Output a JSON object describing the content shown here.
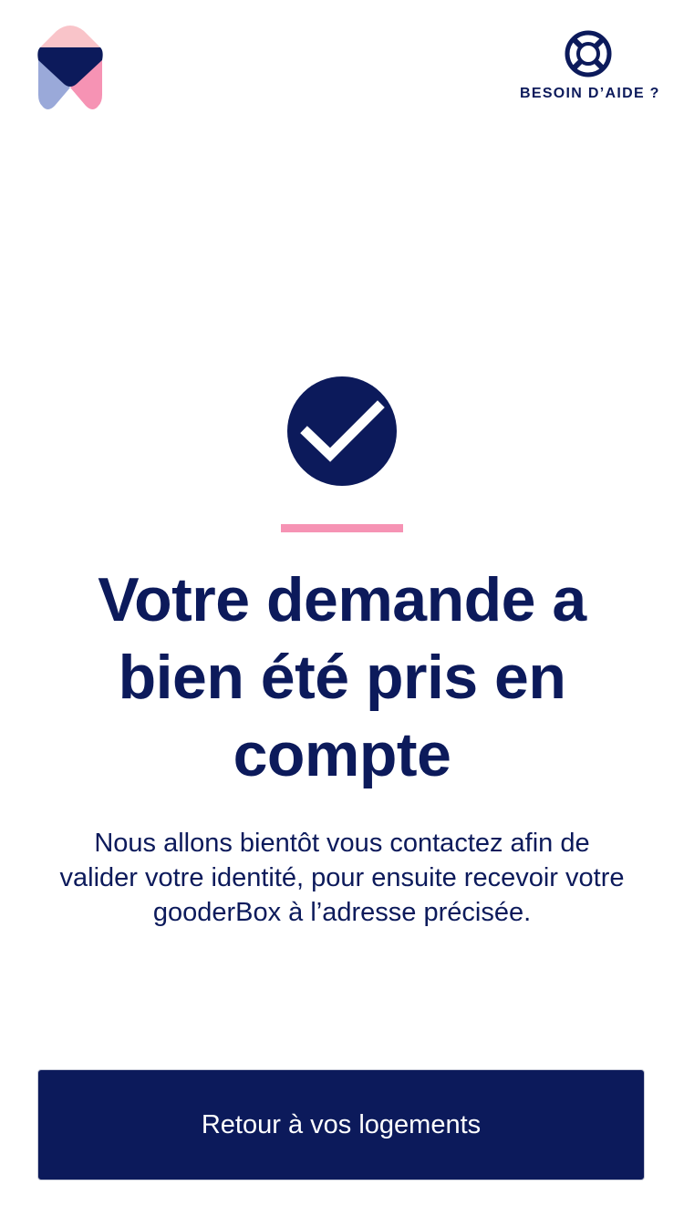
{
  "header": {
    "logo_icon": "house-brand-logo-icon",
    "help_icon": "lifebuoy-icon",
    "help_label": "BESOIN D’AIDE ?"
  },
  "confirmation": {
    "status_icon": "check-circle-icon",
    "title": "Votre demande a bien été pris en compte",
    "message": "Nous allons bientôt vous contactez afin de valider votre identité, pour ensuite recevoir votre gooderBox à l’adresse précisée."
  },
  "actions": {
    "back_label": "Retour à vos logements"
  },
  "colors": {
    "primary_navy": "#0c1a5b",
    "accent_pink": "#f693b4",
    "logo_light_pink": "#f9c4c9",
    "logo_light_blue": "#9aa9d9",
    "background": "#ffffff"
  }
}
